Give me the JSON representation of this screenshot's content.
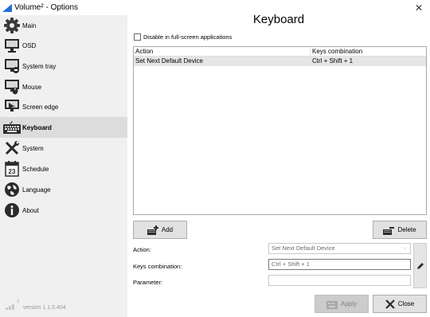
{
  "window": {
    "title": "Volume² - Options"
  },
  "sidebar": {
    "items": [
      {
        "label": "Main",
        "icon": "gear-icon"
      },
      {
        "label": "OSD",
        "icon": "monitor-icon"
      },
      {
        "label": "System tray",
        "icon": "system-tray-icon"
      },
      {
        "label": "Mouse",
        "icon": "mouse-icon"
      },
      {
        "label": "Screen edge",
        "icon": "screen-edge-icon"
      },
      {
        "label": "Keyboard",
        "icon": "keyboard-icon"
      },
      {
        "label": "System",
        "icon": "tools-icon"
      },
      {
        "label": "Schedule",
        "icon": "calendar-icon"
      },
      {
        "label": "Language",
        "icon": "globe-icon"
      },
      {
        "label": "About",
        "icon": "info-icon"
      }
    ],
    "active": "Keyboard",
    "calendar_day": "23",
    "version": "version 1.1.5.404",
    "signal_digit": "3"
  },
  "main": {
    "title": "Keyboard",
    "disable_fullscreen_label": "Disable in full-screen applications",
    "disable_fullscreen_checked": false,
    "table": {
      "columns": [
        "Action",
        "Keys combination"
      ],
      "rows": [
        [
          "Set Next Default Device",
          "Ctrl + Shift + 1"
        ]
      ]
    },
    "add_label": "Add",
    "delete_label": "Delete",
    "action_label": "Action:",
    "action_value": "Set Next Default Device",
    "keys_label": "Keys combination:",
    "keys_value": "Ctrl + Shift + 1",
    "parameter_label": "Parameter:",
    "parameter_value": "",
    "apply_label": "Apply",
    "close_label": "Close"
  }
}
